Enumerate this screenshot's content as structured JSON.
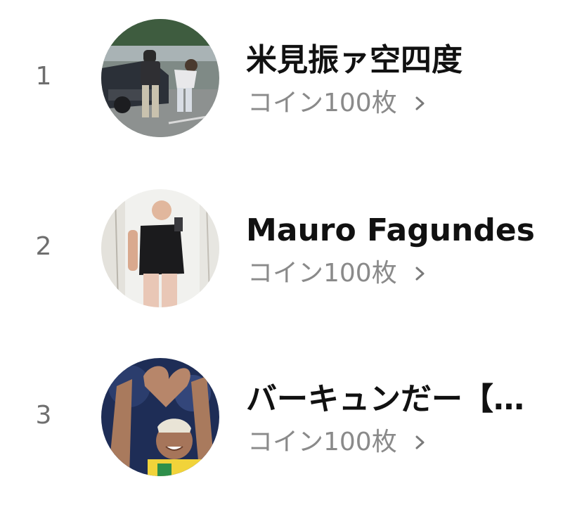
{
  "ranking": [
    {
      "rank": "1",
      "name": "米見振ァ空四度",
      "reward": "コイン100枚"
    },
    {
      "rank": "2",
      "name": "Mauro Fagundes",
      "reward": "コイン100枚"
    },
    {
      "rank": "3",
      "name": "バーキュンだー【…",
      "reward": "コイン100枚"
    }
  ],
  "icons": {
    "chevron": "chevron-right-icon"
  },
  "colors": {
    "name_text": "#111111",
    "reward_text": "#8a8a8a",
    "rank_text": "#6e6e6e",
    "background": "#ffffff"
  }
}
